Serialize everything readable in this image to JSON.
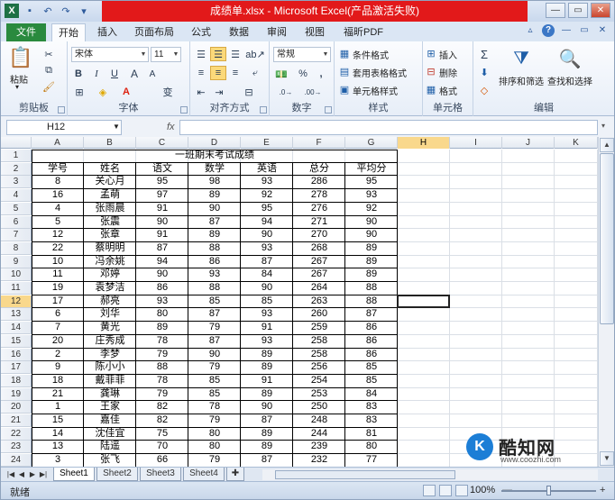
{
  "window": {
    "title": "成绩单.xlsx - Microsoft Excel(产品激活失败)",
    "controls": [
      "—",
      "▭",
      "✕"
    ]
  },
  "tabs": [
    "文件",
    "开始",
    "插入",
    "页面布局",
    "公式",
    "数据",
    "审阅",
    "视图",
    "福昕PDF"
  ],
  "active_tab": "开始",
  "ribbon": {
    "clipboard": {
      "paste": "粘贴",
      "label": "剪贴板"
    },
    "font": {
      "name": "宋体",
      "size": "11",
      "label": "字体",
      "wen": "变"
    },
    "alignment": {
      "label": "对齐方式"
    },
    "number": {
      "format": "常规",
      "label": "数字",
      "percent": "%",
      "comma": ","
    },
    "styles": {
      "conditional": "条件格式",
      "table": "套用表格格式",
      "cell": "单元格样式",
      "label": "样式"
    },
    "cells": {
      "insert": "插入",
      "delete": "删除",
      "format": "格式",
      "label": "单元格"
    },
    "editing": {
      "sort": "排序和筛选",
      "find": "查找和选择",
      "label": "编辑",
      "sum": "Σ"
    }
  },
  "formula_bar": {
    "name_box": "H12",
    "fx": "fx",
    "formula": ""
  },
  "columns": [
    "A",
    "B",
    "C",
    "D",
    "E",
    "F",
    "G",
    "H",
    "I",
    "J",
    "K"
  ],
  "selected_column": "H",
  "rows": [
    "1",
    "2",
    "3",
    "4",
    "5",
    "6",
    "7",
    "8",
    "9",
    "10",
    "11",
    "12",
    "13",
    "14",
    "15",
    "16",
    "17",
    "18",
    "19",
    "20",
    "21",
    "22",
    "23",
    "24"
  ],
  "selected_row": "12",
  "sheet_title": "一班期末考试成绩",
  "headers": [
    "学号",
    "姓名",
    "语文",
    "数学",
    "英语",
    "总分",
    "平均分"
  ],
  "records": [
    [
      "8",
      "关心月",
      "95",
      "98",
      "93",
      "286",
      "95"
    ],
    [
      "16",
      "孟萌",
      "97",
      "89",
      "92",
      "278",
      "93"
    ],
    [
      "4",
      "张雨晨",
      "91",
      "90",
      "95",
      "276",
      "92"
    ],
    [
      "5",
      "张震",
      "90",
      "87",
      "94",
      "271",
      "90"
    ],
    [
      "12",
      "张章",
      "91",
      "89",
      "90",
      "270",
      "90"
    ],
    [
      "22",
      "蔡明明",
      "87",
      "88",
      "93",
      "268",
      "89"
    ],
    [
      "10",
      "冯余姚",
      "94",
      "86",
      "87",
      "267",
      "89"
    ],
    [
      "11",
      "邓婷",
      "90",
      "93",
      "84",
      "267",
      "89"
    ],
    [
      "19",
      "袁梦洁",
      "86",
      "88",
      "90",
      "264",
      "88"
    ],
    [
      "17",
      "郝亮",
      "93",
      "85",
      "85",
      "263",
      "88"
    ],
    [
      "6",
      "刘华",
      "80",
      "87",
      "93",
      "260",
      "87"
    ],
    [
      "7",
      "黄光",
      "89",
      "79",
      "91",
      "259",
      "86"
    ],
    [
      "20",
      "庄秀成",
      "78",
      "87",
      "93",
      "258",
      "86"
    ],
    [
      "2",
      "李梦",
      "79",
      "90",
      "89",
      "258",
      "86"
    ],
    [
      "9",
      "陈小小",
      "88",
      "79",
      "89",
      "256",
      "85"
    ],
    [
      "18",
      "戴菲菲",
      "78",
      "85",
      "91",
      "254",
      "85"
    ],
    [
      "21",
      "龚琳",
      "79",
      "85",
      "89",
      "253",
      "84"
    ],
    [
      "1",
      "王家",
      "82",
      "78",
      "90",
      "250",
      "83"
    ],
    [
      "15",
      "嘉佳",
      "82",
      "79",
      "87",
      "248",
      "83"
    ],
    [
      "14",
      "沈佳宜",
      "75",
      "80",
      "89",
      "244",
      "81"
    ],
    [
      "13",
      "陆遥",
      "70",
      "80",
      "89",
      "239",
      "80"
    ],
    [
      "3",
      "张飞",
      "66",
      "79",
      "87",
      "232",
      "77"
    ]
  ],
  "sheets": [
    "Sheet1",
    "Sheet2",
    "Sheet3",
    "Sheet4"
  ],
  "active_sheet": "Sheet1",
  "status": {
    "ready": "就绪",
    "zoom": "100%",
    "minus": "—",
    "plus": "+"
  },
  "watermark": {
    "brand": "酷知网",
    "url": "www.coozhi.com",
    "logo": "K"
  }
}
